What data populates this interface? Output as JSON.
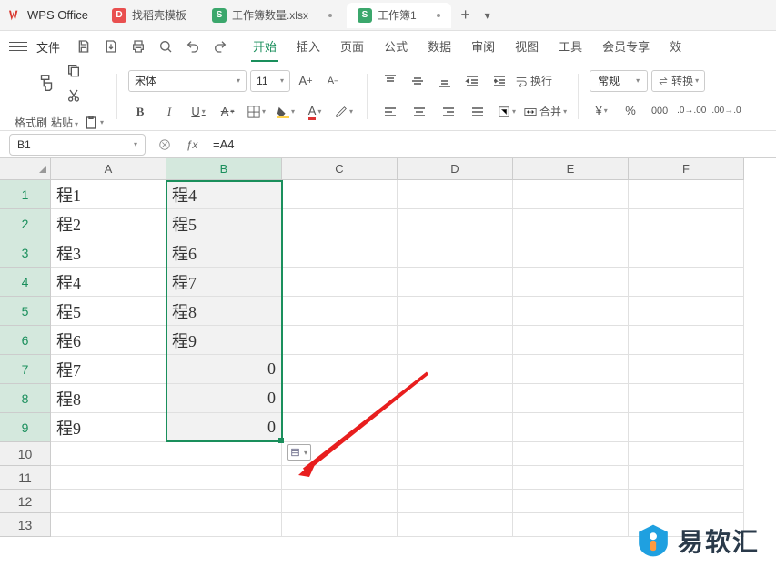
{
  "app": {
    "name": "WPS Office"
  },
  "tabs": [
    {
      "label": "找稻壳模板",
      "icon": "red"
    },
    {
      "label": "工作簿数量.xlsx",
      "icon": "green"
    },
    {
      "label": "工作簿1",
      "icon": "green",
      "active": true
    }
  ],
  "file_menu": "文件",
  "menu_tabs": [
    "开始",
    "插入",
    "页面",
    "公式",
    "数据",
    "审阅",
    "视图",
    "工具",
    "会员专享",
    "效"
  ],
  "active_menu": "开始",
  "toolbar": {
    "format_painter": "格式刷",
    "paste": "粘贴",
    "font": "宋体",
    "font_size": "11",
    "wrap": "换行",
    "merge": "合并",
    "number_format": "常规",
    "convert": "转换"
  },
  "name_box": "B1",
  "formula": "=A4",
  "columns": [
    "A",
    "B",
    "C",
    "D",
    "E",
    "F"
  ],
  "rows": [
    1,
    2,
    3,
    4,
    5,
    6,
    7,
    8,
    9,
    10,
    11,
    12,
    13
  ],
  "cells": {
    "A": [
      "程1",
      "程2",
      "程3",
      "程4",
      "程5",
      "程6",
      "程7",
      "程8",
      "程9",
      "",
      "",
      "",
      ""
    ],
    "B": [
      "程4",
      "程5",
      "程6",
      "程7",
      "程8",
      "程9",
      "0",
      "0",
      "0",
      "",
      "",
      "",
      ""
    ]
  },
  "selected_col": "B",
  "watermark": "易软汇"
}
